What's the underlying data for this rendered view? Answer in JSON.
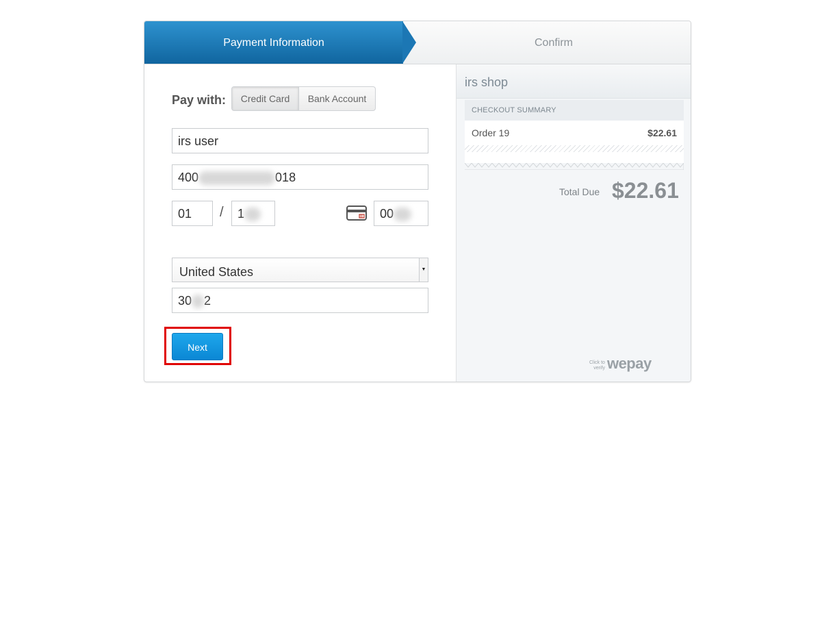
{
  "steps": {
    "active_label": "Payment Information",
    "next_label": "Confirm"
  },
  "form": {
    "pay_with_label": "Pay with:",
    "methods": [
      "Credit Card",
      "Bank Account"
    ],
    "selected_method": "Credit Card",
    "name_value": "irs user",
    "card_number_visible_start": "400",
    "card_number_visible_end": "018",
    "exp_month_value": "01",
    "exp_separator": "/",
    "exp_year_visible": "1",
    "cvv_visible": "00",
    "country_value": "United States",
    "zip_visible_start": "30",
    "zip_visible_end": "2",
    "next_label": "Next"
  },
  "summary": {
    "shop_name": "irs shop",
    "section_title": "CHECKOUT SUMMARY",
    "order_label": "Order 19",
    "order_amount": "$22.61",
    "total_label": "Total Due",
    "total_amount": "$22.61",
    "branding_small": [
      "Click to",
      "verify"
    ],
    "branding_logo": "wepay"
  },
  "colors": {
    "step_active": "#1c77b4",
    "next_button": "#1597e0",
    "highlight_box": "#e00000"
  }
}
